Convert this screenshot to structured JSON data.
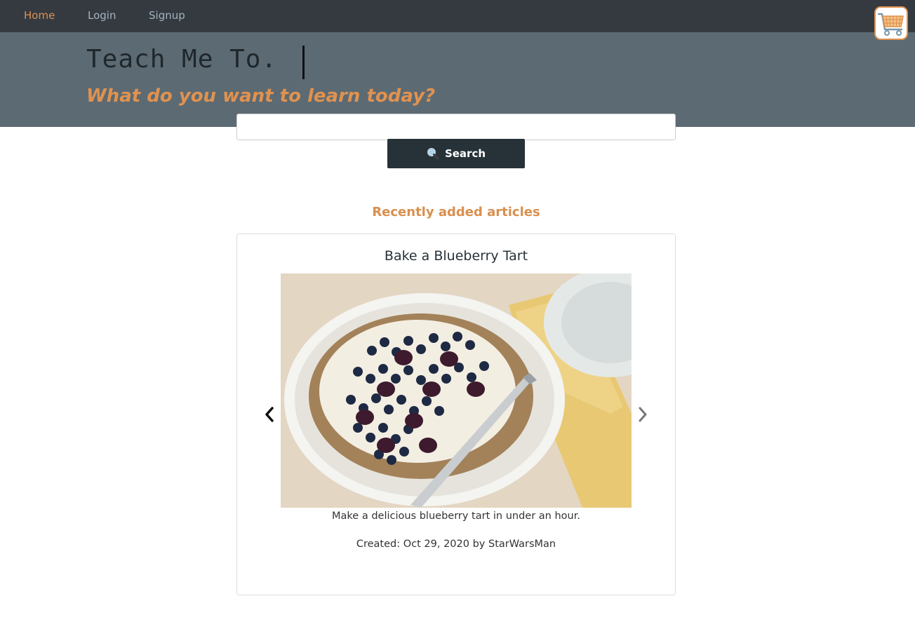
{
  "nav": {
    "items": [
      {
        "label": "Home",
        "active": true
      },
      {
        "label": "Login",
        "active": false
      },
      {
        "label": "Signup",
        "active": false
      }
    ],
    "cart_icon": "shopping-cart-icon"
  },
  "hero": {
    "title": "Teach Me To.",
    "subtitle": "What do you want to learn today?"
  },
  "search": {
    "value": "",
    "placeholder": "",
    "button_label": "Search",
    "button_icon": "magnifier-icon"
  },
  "articles": {
    "section_title": "Recently added articles",
    "current": {
      "title": "Bake a Blueberry Tart",
      "description": "Make a delicious blueberry tart in under an hour.",
      "meta": "Created: Oct 29, 2020 by StarWarsMan"
    }
  },
  "colors": {
    "nav_bg": "#343a40",
    "hero_bg": "#5c6a73",
    "accent": "#e0924f",
    "button_bg": "#263238"
  }
}
